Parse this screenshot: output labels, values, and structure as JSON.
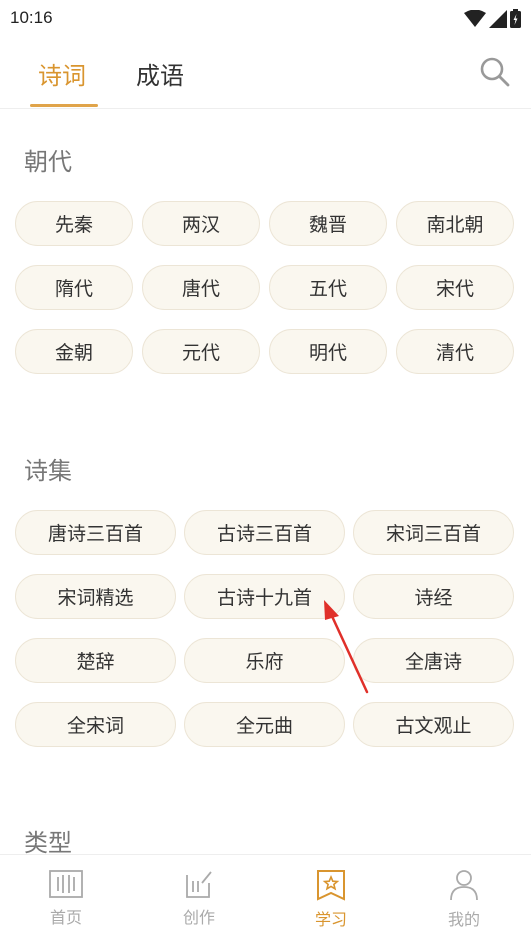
{
  "status": {
    "time": "10:16"
  },
  "tabs": [
    {
      "label": "诗词",
      "active": true
    },
    {
      "label": "成语",
      "active": false
    }
  ],
  "sections": {
    "dynasty": {
      "title": "朝代",
      "items": [
        "先秦",
        "两汉",
        "魏晋",
        "南北朝",
        "隋代",
        "唐代",
        "五代",
        "宋代",
        "金朝",
        "元代",
        "明代",
        "清代"
      ]
    },
    "collection": {
      "title": "诗集",
      "items": [
        "唐诗三百首",
        "古诗三百首",
        "宋词三百首",
        "宋词精选",
        "古诗十九首",
        "诗经",
        "楚辞",
        "乐府",
        "全唐诗",
        "全宋词",
        "全元曲",
        "古文观止"
      ]
    },
    "type": {
      "title": "类型"
    }
  },
  "bottom_nav": [
    {
      "label": "首页",
      "icon": "home-icon",
      "active": false
    },
    {
      "label": "创作",
      "icon": "compose-icon",
      "active": false
    },
    {
      "label": "学习",
      "icon": "study-icon",
      "active": true
    },
    {
      "label": "我的",
      "icon": "profile-icon",
      "active": false
    }
  ],
  "colors": {
    "accent": "#d9952f",
    "chip_bg": "#faf7ef",
    "chip_border": "#ece5d6",
    "annotation": "#e0302a"
  }
}
